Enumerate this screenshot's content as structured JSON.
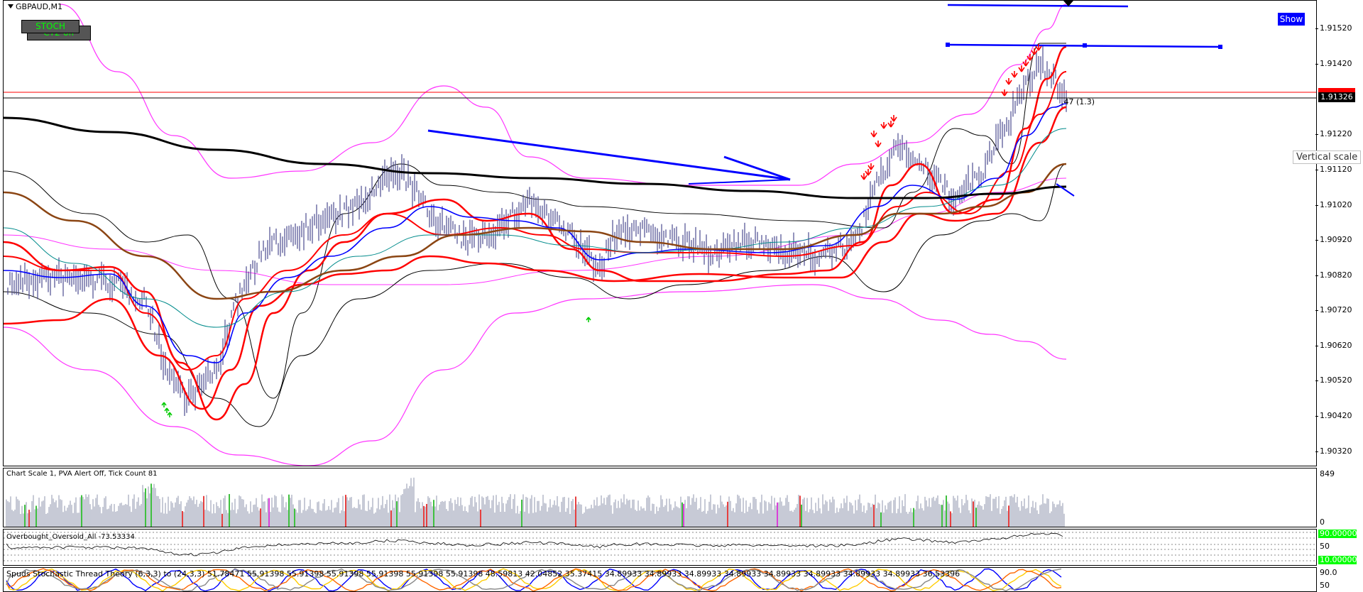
{
  "window": {
    "symbol_label": "GBPAUD,M1"
  },
  "buttons": {
    "stoch_back": "CT2-off",
    "stoch_front": "STOCH",
    "show": "Show"
  },
  "price_axis": {
    "ticks": [
      "1.91520",
      "1.91420",
      "1.91220",
      "1.91120",
      "1.91020",
      "1.90920",
      "1.90820",
      "1.90720",
      "1.90620",
      "1.90520",
      "1.90420",
      "1.90320"
    ],
    "current_price": "1.91326",
    "hover_label": "Vertical scale"
  },
  "annotations": {
    "bar_text": ".47 (1.3)"
  },
  "volume_pane": {
    "label": "Chart Scale  1,   PVA Alert Off,   Tick Count  81",
    "max": "849",
    "min": "0"
  },
  "ob_pane": {
    "label": "Overbought_Oversold_All -73.53334",
    "upper": "90.00000",
    "mid": "50",
    "lower": "10.00000"
  },
  "stoch_pane": {
    "label": "Spuds Stochastic Thread Theory (6,3,3) to (24,3,3) 51.78471 55.91398 55.91398 55.91398 55.91398 55.91398 55.91398 48.59813 42.04852 35.37415 34.89933 34.89933 34.89933 34.89933 34.89933 34.89933 34.89933 34.89933 36.53396",
    "r1": "90.0",
    "r2": "50"
  },
  "colors": {
    "price_bars": "#4b4b8f",
    "bull_volume": "#00aa00",
    "bear_volume": "#dd0000",
    "neutral_volume": "#b4b9c8",
    "blue_line": "#0000ff",
    "red_band": "#ff0000",
    "magenta_band": "#ff33ff",
    "brown_ma": "#8b4513"
  }
}
